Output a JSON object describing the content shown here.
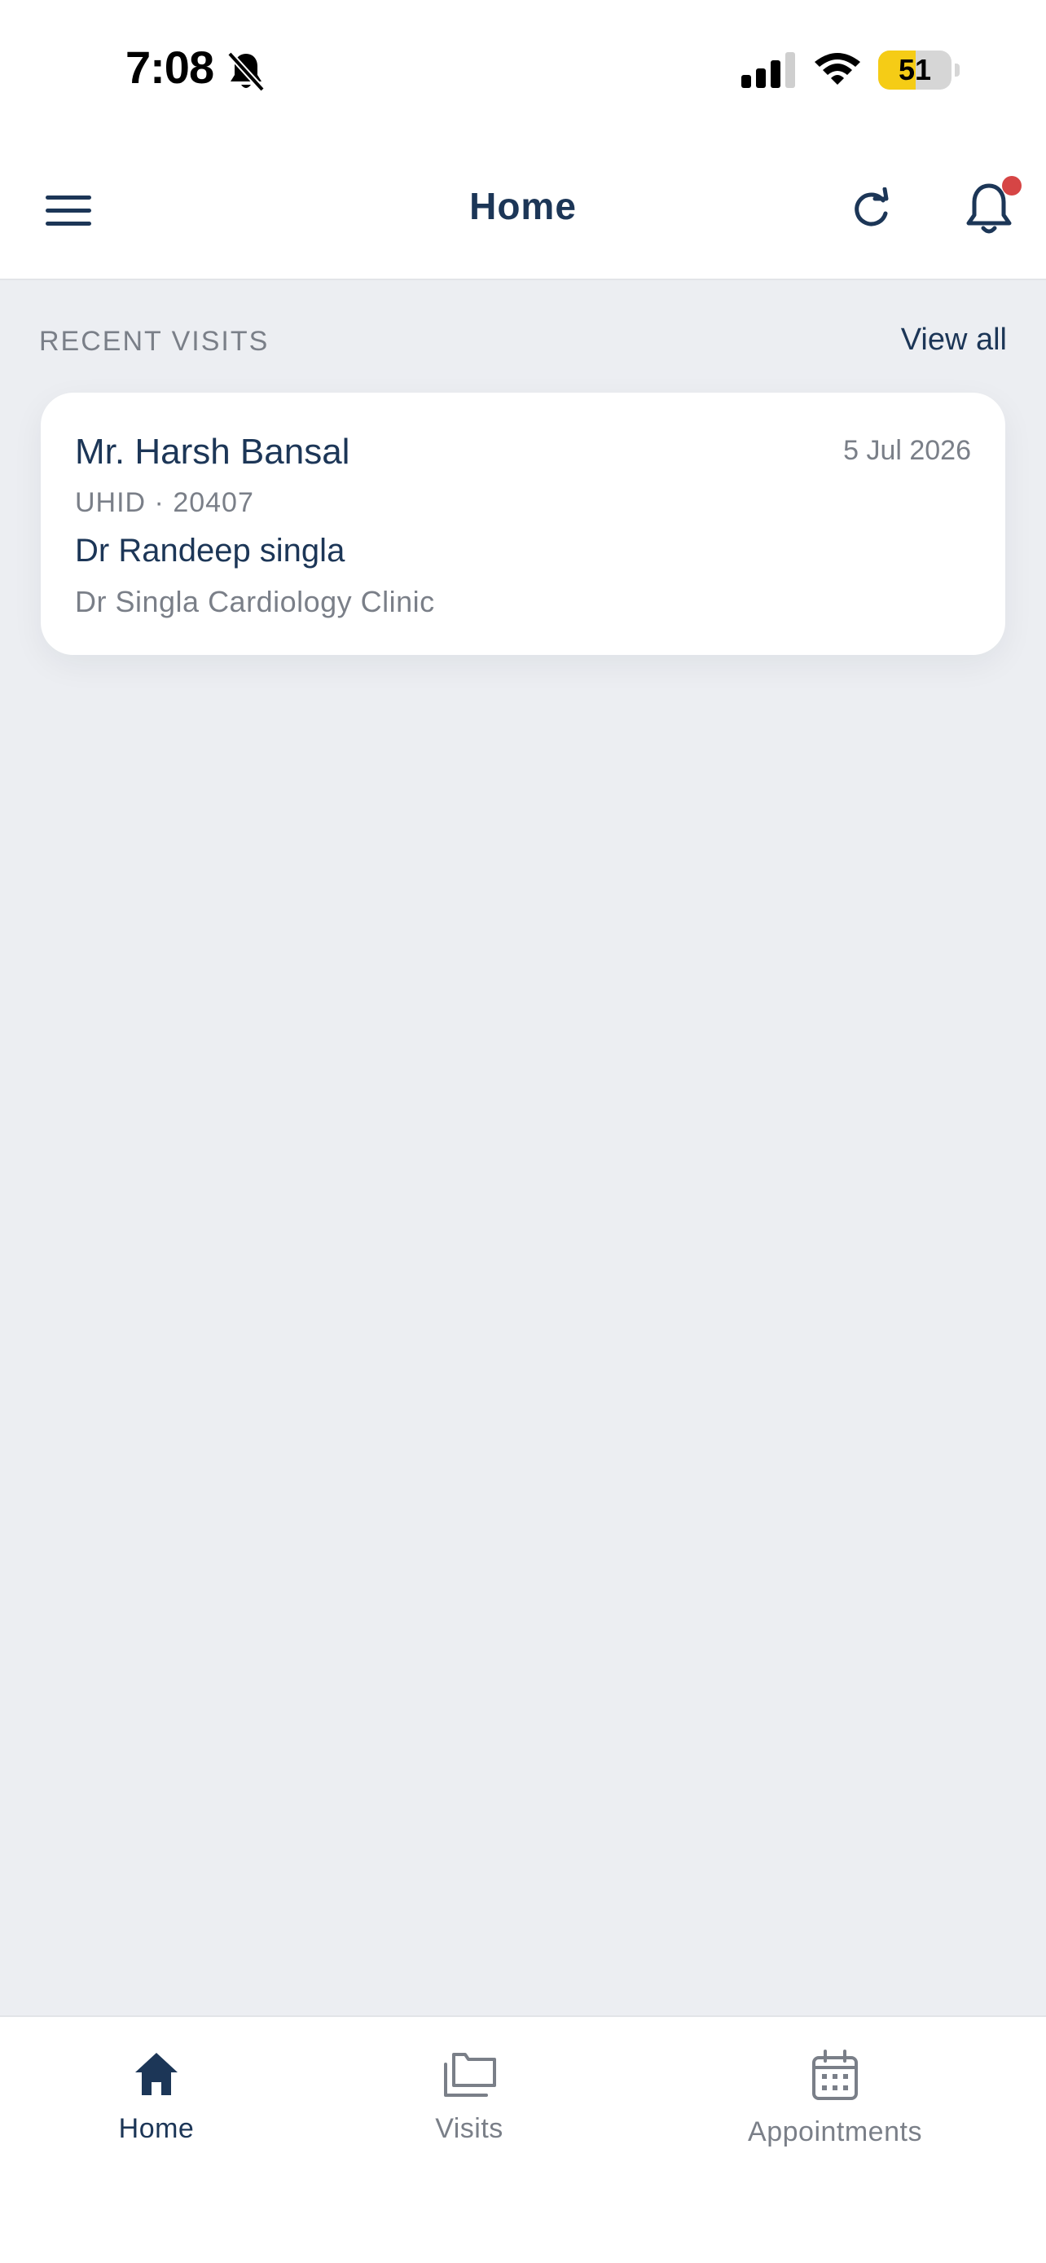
{
  "status_bar": {
    "time": "7:08",
    "battery_level": 51,
    "battery_label": "51",
    "icons": [
      "bell-muted-icon",
      "cellular-signal-icon",
      "wifi-icon",
      "battery-icon"
    ]
  },
  "header": {
    "title": "Home",
    "icons": [
      "hamburger-menu-icon",
      "refresh-icon",
      "bell-icon"
    ],
    "has_unread_notification": true
  },
  "recent_visits": {
    "section_title": "RECENT VISITS",
    "view_all_label": "View all",
    "items": [
      {
        "patient_name": "Mr. Harsh Bansal",
        "date": "5 Jul 2026",
        "uhid": "UHID · 20407",
        "doctor": "Dr Randeep singla",
        "clinic": "Dr Singla Cardiology Clinic"
      }
    ]
  },
  "bottom_nav": {
    "items": [
      {
        "label": "Home",
        "icon": "home-icon",
        "active": true
      },
      {
        "label": "Visits",
        "icon": "folders-icon",
        "active": false
      },
      {
        "label": "Appointments",
        "icon": "calendar-icon",
        "active": false
      }
    ]
  },
  "colors": {
    "primary": "#1c3657",
    "muted_text": "#7a7f88",
    "background": "#eceef2",
    "notification_dot": "#d64545",
    "battery_fill": "#f5cc16"
  }
}
